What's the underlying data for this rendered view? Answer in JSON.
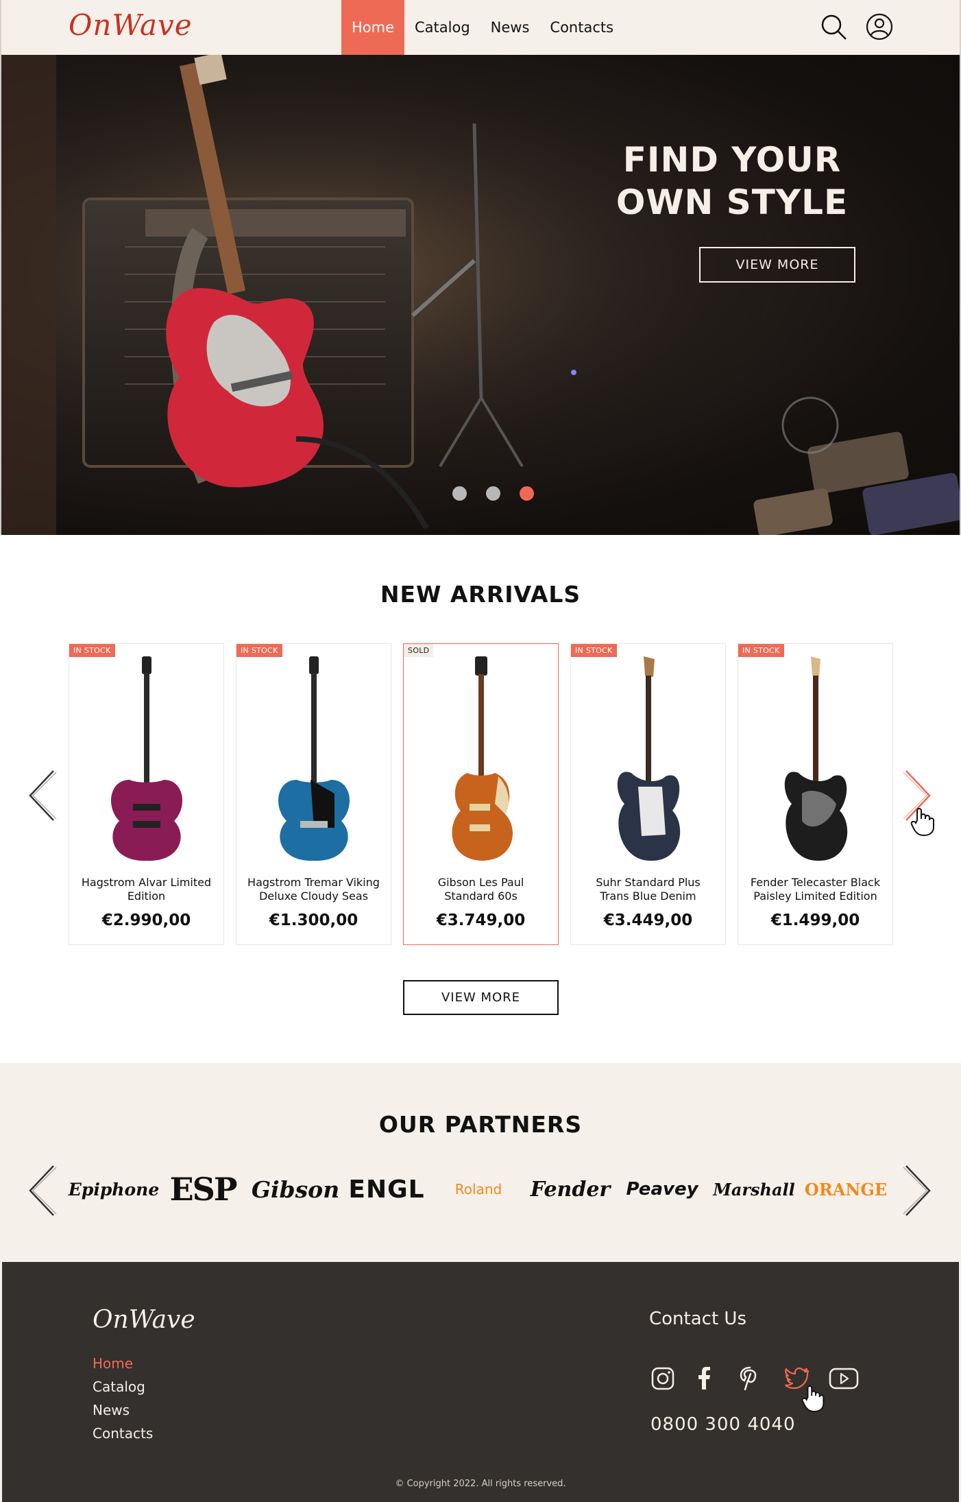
{
  "header": {
    "logo": "OnWave",
    "nav": [
      "Home",
      "Catalog",
      "News",
      "Contacts"
    ],
    "active_nav": "Home",
    "icons": [
      "search-icon",
      "user-account-icon"
    ]
  },
  "hero": {
    "title_line1": "FIND YOUR",
    "title_line2": "OWN STYLE",
    "button": "VIEW MORE",
    "slides": 3,
    "active_slide": 3
  },
  "arrivals": {
    "title": "NEW ARRIVALS",
    "products": [
      {
        "badge": "IN STOCK",
        "name_line1": "Hagstrom Alvar Limited",
        "name_line2": "Edition",
        "price": "€2.990,00",
        "color": "#8a1c55"
      },
      {
        "badge": "IN STOCK",
        "name_line1": "Hagstrom Tremar Viking",
        "name_line2": "Deluxe Cloudy Seas",
        "price": "€1.300,00",
        "color": "#1c6ea3"
      },
      {
        "badge": "SOLD",
        "name_line1": "Gibson Les Paul",
        "name_line2": "Standard 60s",
        "price": "€3.749,00",
        "color": "#c8631d"
      },
      {
        "badge": "IN STOCK",
        "name_line1": "Suhr Standard Plus",
        "name_line2": "Trans Blue Denim",
        "price": "€3.449,00",
        "color": "#2b3346"
      },
      {
        "badge": "IN STOCK",
        "name_line1": "Fender Telecaster Black",
        "name_line2": "Paisley Limited Edition",
        "price": "€1.499,00",
        "color": "#1d1d1d"
      }
    ],
    "button": "VIEW MORE"
  },
  "partners": {
    "title": "OUR PARTNERS",
    "logos": [
      "Epiphone",
      "ESP",
      "Gibson",
      "ENGL",
      "Roland",
      "Fender",
      "Peavey",
      "Marshall",
      "ORANGE"
    ]
  },
  "footer": {
    "logo": "OnWave",
    "links": [
      "Home",
      "Catalog",
      "News",
      "Contacts"
    ],
    "contact_title": "Contact Us",
    "social": [
      "instagram-icon",
      "facebook-icon",
      "pinterest-icon",
      "twitter-icon",
      "youtube-icon"
    ],
    "phone": "0800 300 4040",
    "copyright": "© Copyright 2022. All rights reserved."
  },
  "colors": {
    "accent": "#ef6a55",
    "cream": "#f6f0ea",
    "footer": "#33302d",
    "logo": "#c8321f"
  }
}
